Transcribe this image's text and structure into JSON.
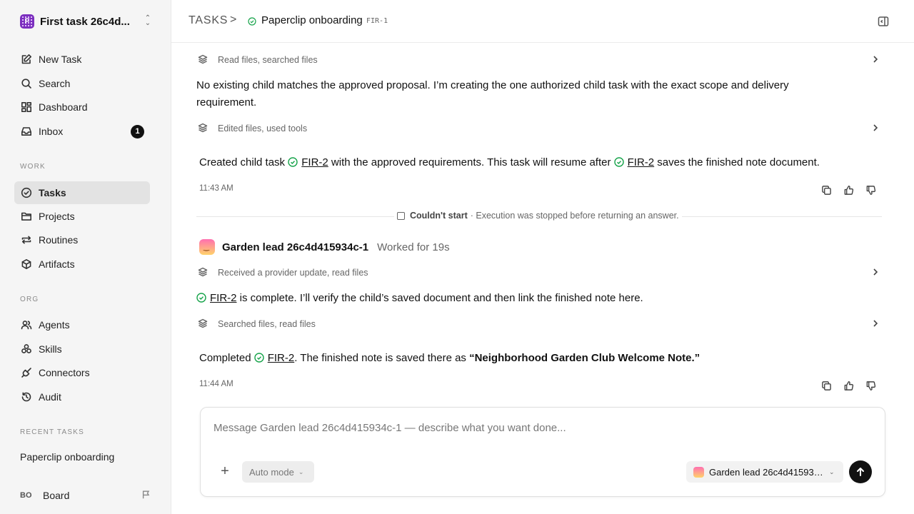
{
  "workspace": {
    "logo_letter": "F",
    "name": "First task 26c4d..."
  },
  "sidebar": {
    "top_items": [
      {
        "label": "New Task",
        "icon": "edit-icon"
      },
      {
        "label": "Search",
        "icon": "search-icon"
      },
      {
        "label": "Dashboard",
        "icon": "dashboard-icon"
      },
      {
        "label": "Inbox",
        "icon": "inbox-icon",
        "badge": "1"
      }
    ],
    "work_label": "WORK",
    "work_items": [
      {
        "label": "Tasks",
        "icon": "check-circle-icon",
        "active": true
      },
      {
        "label": "Projects",
        "icon": "folder-icon"
      },
      {
        "label": "Routines",
        "icon": "repeat-icon"
      },
      {
        "label": "Artifacts",
        "icon": "cube-icon"
      }
    ],
    "org_label": "ORG",
    "org_items": [
      {
        "label": "Agents",
        "icon": "users-icon"
      },
      {
        "label": "Skills",
        "icon": "skills-icon"
      },
      {
        "label": "Connectors",
        "icon": "plug-icon"
      },
      {
        "label": "Audit",
        "icon": "history-icon"
      }
    ],
    "recent_label": "RECENT TASKS",
    "recent_items": [
      "Paperclip onboarding"
    ],
    "board": {
      "initials": "BO",
      "name": "Board"
    }
  },
  "header": {
    "root": "TASKS",
    "separator": ">",
    "title": "Paperclip onboarding",
    "task_id": "FIR-1"
  },
  "thread": {
    "activity_1": "Read files, searched files",
    "text_1": "No existing child matches the approved proposal. I’m creating the one authorized child task with the exact scope and delivery requirement.",
    "activity_2": "Edited files, used tools",
    "msg_1": {
      "prefix": "Created child task ",
      "link1": "FIR-2",
      "middle": " with the approved requirements. This task will resume after ",
      "link2": "FIR-2",
      "suffix": " saves the finished note document."
    },
    "time_1": "11:43 AM",
    "divider": {
      "title": "Couldn't start",
      "detail": "· Execution was stopped before returning an answer."
    },
    "agent": {
      "name": "Garden lead 26c4d415934c-1",
      "worked": "Worked for 19s"
    },
    "activity_3": "Received a provider update, read files",
    "text_2": {
      "link": "FIR-2",
      "rest": " is complete. I’ll verify the child’s saved document and then link the finished note here."
    },
    "activity_4": "Searched files, read files",
    "msg_2": {
      "prefix": "Completed ",
      "link": "FIR-2",
      "middle": ". The finished note is saved there as ",
      "bold": "“Neighborhood Garden Club Welcome Note.”"
    },
    "time_2": "11:44 AM"
  },
  "composer": {
    "placeholder": "Message Garden lead 26c4d415934c-1 — describe what you want done...",
    "mode": "Auto mode",
    "agent": "Garden lead 26c4d415934c-1"
  },
  "colors": {
    "accent_green": "#16a34a",
    "brand_purple": "#7b2fbe"
  }
}
